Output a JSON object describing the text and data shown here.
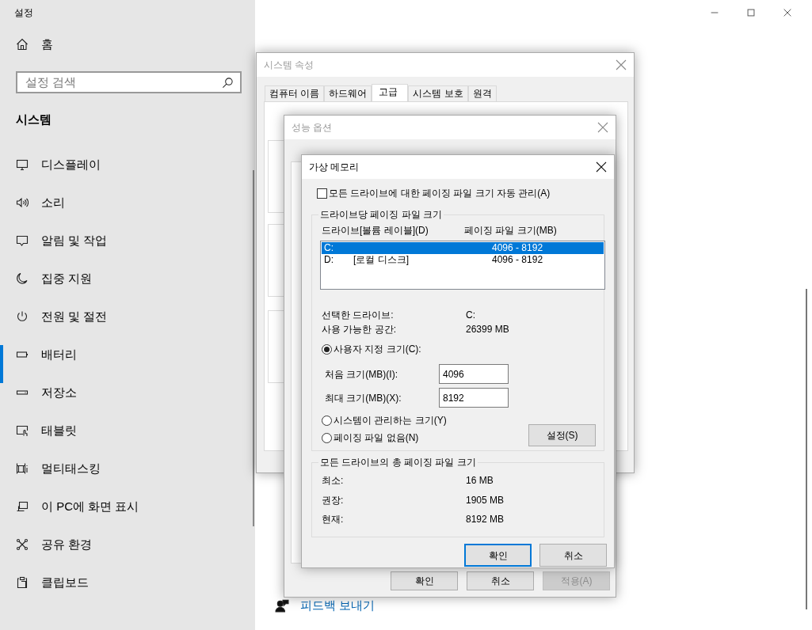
{
  "settings": {
    "title": "설정",
    "home": "홈",
    "search": {
      "placeholder": "설정 검색"
    },
    "section": "시스템",
    "items": [
      {
        "label": "디스플레이",
        "kind": "monitor",
        "selected": false
      },
      {
        "label": "소리",
        "kind": "speaker",
        "selected": false
      },
      {
        "label": "알림 및 작업",
        "kind": "bubble",
        "selected": false
      },
      {
        "label": "집중 지원",
        "kind": "moon",
        "selected": false
      },
      {
        "label": "전원 및 절전",
        "kind": "power",
        "selected": false
      },
      {
        "label": "배터리",
        "kind": "battery",
        "selected": true
      },
      {
        "label": "저장소",
        "kind": "drive",
        "selected": false
      },
      {
        "label": "태블릿",
        "kind": "tablet",
        "selected": false
      },
      {
        "label": "멀티태스킹",
        "kind": "multitask",
        "selected": false
      },
      {
        "label": "이 PC에 화면 표시",
        "kind": "project",
        "selected": false
      },
      {
        "label": "공유 환경",
        "kind": "share",
        "selected": false
      },
      {
        "label": "클립보드",
        "kind": "clipboard",
        "selected": false
      }
    ],
    "feedback_link": "피드백 보내기"
  },
  "system_properties": {
    "title": "시스템 속성",
    "tabs": [
      {
        "label": "컴퓨터 이름",
        "selected": false
      },
      {
        "label": "하드웨어",
        "selected": false
      },
      {
        "label": "고급",
        "selected": true
      },
      {
        "label": "시스템 보호",
        "selected": false
      },
      {
        "label": "원격",
        "selected": false
      }
    ]
  },
  "performance_options": {
    "title": "성능 옵션",
    "buttons": [
      {
        "label": "확인",
        "disabled": false
      },
      {
        "label": "취소",
        "disabled": false
      },
      {
        "label": "적용(A)",
        "disabled": true
      }
    ]
  },
  "virtual_memory": {
    "title": "가상 메모리",
    "auto_manage": {
      "label": "모든 드라이브에 대한 페이징 파일 크기 자동 관리(A)",
      "checked": false
    },
    "per_drive_group": "드라이브당 페이징 파일 크기",
    "columns": [
      "드라이브[볼륨 레이블](D)",
      "페이징 파일 크기(MB)"
    ],
    "drives": [
      {
        "drive": "C:",
        "size": "4096 - 8192",
        "selected": true
      },
      {
        "drive": "D:",
        "label": "[로컬 디스크]",
        "size": "4096 - 8192",
        "selected": false
      }
    ],
    "info": [
      {
        "label": "선택한 드라이브:",
        "value": "C:"
      },
      {
        "label": "사용 가능한 공간:",
        "value": "26399 MB"
      }
    ],
    "custom_size": {
      "label": "사용자 지정 크기(C):",
      "selected": true
    },
    "initial_size": {
      "label": "처음 크기(MB)(I):",
      "value": "4096"
    },
    "max_size": {
      "label": "최대 크기(MB)(X):",
      "value": "8192"
    },
    "system_managed": {
      "label": "시스템이 관리하는 크기(Y)",
      "selected": false
    },
    "no_paging": {
      "label": "페이징 파일 없음(N)",
      "selected": false
    },
    "set_button": "설정(S)",
    "total_group": "모든 드라이브의 총 페이징 파일 크기",
    "totals": [
      {
        "label": "최소:",
        "value": "16 MB"
      },
      {
        "label": "권장:",
        "value": "1905 MB"
      },
      {
        "label": "현재:",
        "value": "8192 MB"
      }
    ],
    "buttons": [
      {
        "label": "확인",
        "default": true
      },
      {
        "label": "취소",
        "default": false
      }
    ]
  }
}
